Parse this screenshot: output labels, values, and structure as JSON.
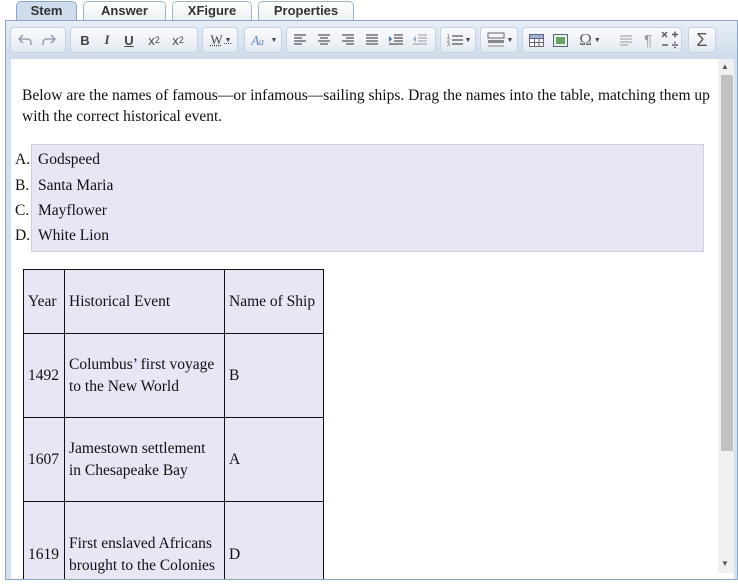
{
  "tabs": [
    "Stem",
    "Answer",
    "XFigure",
    "Properties"
  ],
  "toolbar": {
    "bold": "B",
    "italic": "I",
    "underline": "U",
    "subscript_base": "x",
    "subscript_mark": "2",
    "superscript_base": "x",
    "superscript_mark": "2",
    "style_label": "W",
    "special_char": "Ω",
    "sum": "Σ"
  },
  "stem_text": "Below are the names of famous—or infamous—sailing ships. Drag the names into the table, matching them up with the correct historical event.",
  "choices": [
    {
      "label": "A.",
      "text": "Godspeed"
    },
    {
      "label": "B.",
      "text": "Santa Maria"
    },
    {
      "label": "C.",
      "text": "Mayflower"
    },
    {
      "label": "D.",
      "text": "White Lion"
    }
  ],
  "table": {
    "headers": [
      "Year",
      "Historical Event",
      "Name of Ship"
    ],
    "rows": [
      [
        "1492",
        "Columbus’ first voyage to the New World",
        "B"
      ],
      [
        "1607",
        "Jamestown settlement in Chesapeake Bay",
        "A"
      ],
      [
        "1619",
        "First enslaved Africans brought to the Colonies",
        "D"
      ]
    ]
  }
}
